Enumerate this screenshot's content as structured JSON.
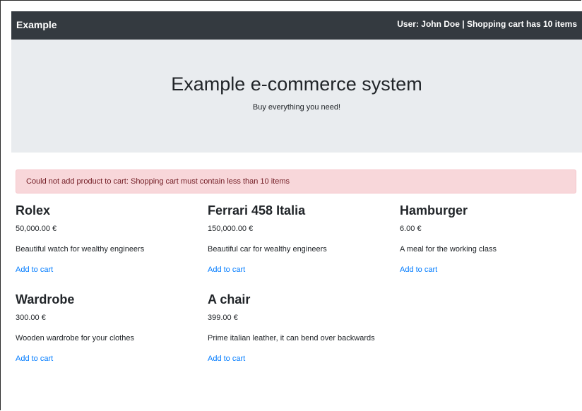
{
  "navbar": {
    "brand": "Example",
    "status": "User: John Doe | Shopping cart has 10 items"
  },
  "jumbotron": {
    "title": "Example e-commerce system",
    "subtitle": "Buy everything you need!"
  },
  "alert": {
    "message": "Could not add product to cart: Shopping cart must contain less than 10 items"
  },
  "products": [
    {
      "name": "Rolex",
      "price": "50,000.00 €",
      "description": "Beautiful watch for wealthy engineers",
      "action": "Add to cart"
    },
    {
      "name": "Ferrari 458 Italia",
      "price": "150,000.00 €",
      "description": "Beautiful car for wealthy engineers",
      "action": "Add to cart"
    },
    {
      "name": "Hamburger",
      "price": "6.00 €",
      "description": "A meal for the working class",
      "action": "Add to cart"
    },
    {
      "name": "Wardrobe",
      "price": "300.00 €",
      "description": "Wooden wardrobe for your clothes",
      "action": "Add to cart"
    },
    {
      "name": "A chair",
      "price": "399.00 €",
      "description": "Prime italian leather, it can bend over backwards",
      "action": "Add to cart"
    }
  ],
  "colors": {
    "navbar_bg": "#343a40",
    "jumbotron_bg": "#e9ecef",
    "alert_bg": "#f8d7da",
    "alert_text": "#721c24",
    "link": "#007bff"
  }
}
